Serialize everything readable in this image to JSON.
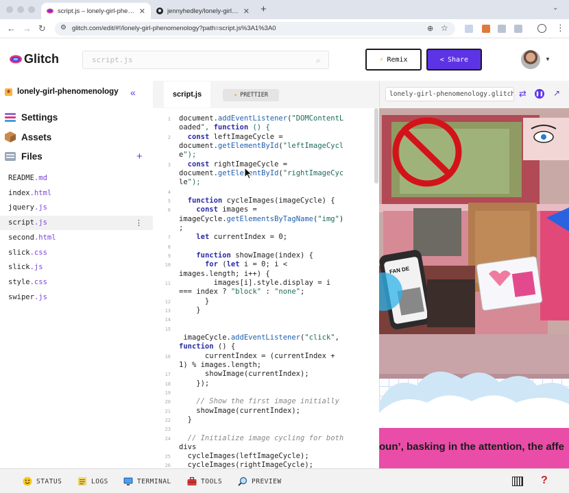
{
  "browser": {
    "tabs": [
      {
        "title": "script.js – lonely-girl-phenomenology",
        "active": true,
        "favicon": "glitch-icon"
      },
      {
        "title": "jennyhedley/lonely-girl-phenomenology",
        "active": false,
        "favicon": "github-icon"
      }
    ],
    "new_tab": "+",
    "url": "glitch.com/edit/#!/lonely-girl-phenomenology?path=script.js%3A1%3A0"
  },
  "header": {
    "logo_text": "Glitch",
    "search_placeholder": "script.js",
    "remix_label": "Remix",
    "share_label": "Share"
  },
  "sidebar": {
    "project_name": "lonely-girl-phenomenology",
    "nav": [
      {
        "label": "Settings",
        "icon": "settings-icon"
      },
      {
        "label": "Assets",
        "icon": "assets-box-icon"
      },
      {
        "label": "Files",
        "icon": "files-icon"
      }
    ],
    "files": [
      {
        "name": "README",
        "ext": ".md",
        "selected": false
      },
      {
        "name": "index",
        "ext": ".html",
        "selected": false
      },
      {
        "name": "jquery",
        "ext": ".js",
        "selected": false
      },
      {
        "name": "script",
        "ext": ".js",
        "selected": true
      },
      {
        "name": "second",
        "ext": ".html",
        "selected": false
      },
      {
        "name": "slick",
        "ext": ".css",
        "selected": false
      },
      {
        "name": "slick",
        "ext": ".js",
        "selected": false
      },
      {
        "name": "style",
        "ext": ".css",
        "selected": false
      },
      {
        "name": "swiper",
        "ext": ".js",
        "selected": false
      }
    ]
  },
  "editor": {
    "tab_label": "script.js",
    "prettier_label": "PRETTIER",
    "line_numbers": [
      "1",
      "2",
      "3",
      "4",
      "5",
      "6",
      "7",
      "8",
      "9",
      "10",
      "11",
      "12",
      "13",
      "14",
      "15",
      "16",
      "17",
      "18",
      "19",
      "20",
      "21",
      "22",
      "23",
      "24",
      "25",
      "26"
    ],
    "code_rows": [
      {
        "ln": "1",
        "text": "document.addEventListener(\"DOMContentL"
      },
      {
        "ln": "",
        "text": "oaded\", function () {"
      },
      {
        "ln": "2",
        "text": "  const leftImageCycle ="
      },
      {
        "ln": "",
        "text": "document.getElementById(\"leftImageCycl"
      },
      {
        "ln": "",
        "text": "e\");"
      },
      {
        "ln": "3",
        "text": "  const rightImageCycle ="
      },
      {
        "ln": "",
        "text": "document.getElementById(\"rightImageCyc"
      },
      {
        "ln": "",
        "text": "le\");"
      },
      {
        "ln": "4",
        "text": ""
      },
      {
        "ln": "5",
        "text": "  function cycleImages(imageCycle) {"
      },
      {
        "ln": "6",
        "text": "    const images ="
      },
      {
        "ln": "",
        "text": "imageCycle.getElementsByTagName(\"img\")"
      },
      {
        "ln": "",
        "text": ";"
      },
      {
        "ln": "7",
        "text": "    let currentIndex = 0;"
      },
      {
        "ln": "8",
        "text": ""
      },
      {
        "ln": "9",
        "text": "    function showImage(index) {"
      },
      {
        "ln": "10",
        "text": "      for (let i = 0; i <"
      },
      {
        "ln": "",
        "text": "images.length; i++) {"
      },
      {
        "ln": "11",
        "text": "        images[i].style.display = i"
      },
      {
        "ln": "",
        "text": "=== index ? \"block\" : \"none\";"
      },
      {
        "ln": "12",
        "text": "      }"
      },
      {
        "ln": "13",
        "text": "    }"
      },
      {
        "ln": "14",
        "text": ""
      },
      {
        "ln": "15",
        "text": ""
      },
      {
        "ln": "",
        "text": " imageCycle.addEventListener(\"click\","
      },
      {
        "ln": "",
        "text": "function () {"
      },
      {
        "ln": "16",
        "text": "      currentIndex = (currentIndex +"
      },
      {
        "ln": "",
        "text": "1) % images.length;"
      },
      {
        "ln": "17",
        "text": "      showImage(currentIndex);"
      },
      {
        "ln": "18",
        "text": "    });"
      },
      {
        "ln": "19",
        "text": ""
      },
      {
        "ln": "20",
        "text": "    // Show the first image initially"
      },
      {
        "ln": "21",
        "text": "    showImage(currentIndex);"
      },
      {
        "ln": "22",
        "text": "  }"
      },
      {
        "ln": "23",
        "text": ""
      },
      {
        "ln": "24",
        "text": "  // Initialize image cycling for both"
      },
      {
        "ln": "",
        "text": "divs"
      },
      {
        "ln": "25",
        "text": "  cycleImages(leftImageCycle);"
      },
      {
        "ln": "26",
        "text": "  cycleImages(rightImageCycle);"
      }
    ]
  },
  "preview": {
    "url": "lonely-girl-phenomenology.glitch.me",
    "marquee": "oun’, basking in the attention, the affe",
    "fanzine_title": "FAN DE SOLITUDE"
  },
  "statusbar": {
    "items": [
      {
        "label": "STATUS",
        "icon": "status-smiley-icon"
      },
      {
        "label": "LOGS",
        "icon": "logs-notepad-icon"
      },
      {
        "label": "TERMINAL",
        "icon": "terminal-monitor-icon"
      },
      {
        "label": "TOOLS",
        "icon": "tools-toolbox-icon"
      },
      {
        "label": "PREVIEW",
        "icon": "preview-magnifier-icon"
      }
    ],
    "help": "?"
  },
  "colors": {
    "accent": "#5d33e6",
    "marquee_bg": "#e94da8",
    "file_ext": "#7a42d9",
    "help_red": "#c81e2d"
  }
}
